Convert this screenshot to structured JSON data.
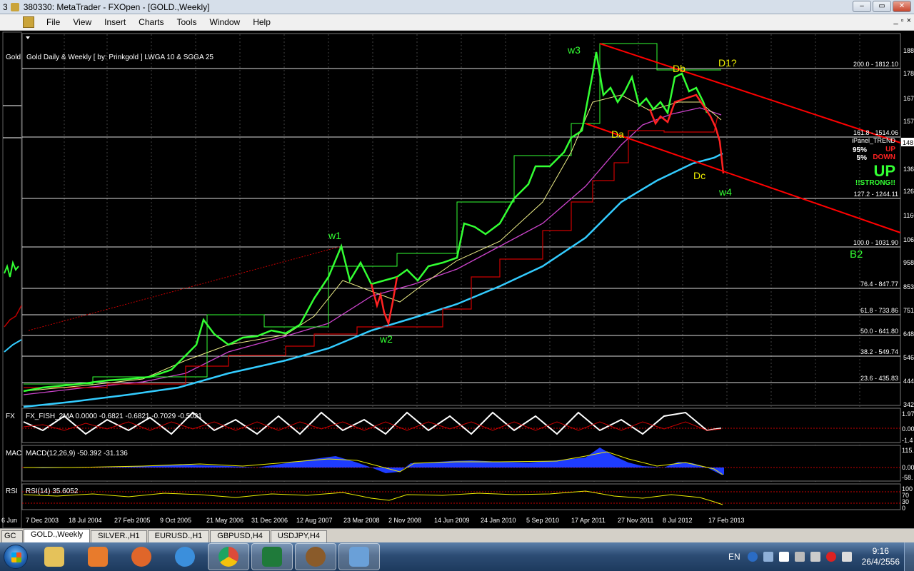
{
  "window": {
    "title_prefix": "3",
    "title": "380330: MetaTrader - FXOpen - [GOLD.,Weekly]",
    "controls": [
      "–",
      "▭",
      "✕"
    ]
  },
  "menu": {
    "items": [
      "File",
      "View",
      "Insert",
      "Charts",
      "Tools",
      "Window",
      "Help"
    ],
    "mdi_controls": [
      "_",
      "▫",
      "×"
    ]
  },
  "chart": {
    "symbol_label": "Gold",
    "header": "Gold Daily & Weekly [ by: Prinkgold ] LWGA 10 & SGGA 25",
    "price_axis": [
      "1880",
      "1780",
      "1670",
      "1570",
      "1480",
      "1360",
      "1260",
      "1160",
      "1060",
      "958",
      "853",
      "751",
      "648",
      "546",
      "444",
      "342"
    ],
    "price_box": "148",
    "fib_levels": [
      "200.0 - 1812.10",
      "161.8 - 1514.06",
      "127.2 - 1244.11",
      "100.0 - 1031.90",
      "76.4 - 847.77",
      "61.8 - 733.86",
      "50.0 - 641.80",
      "38.2 - 549.74",
      "23.6 - 435.83"
    ],
    "wave_labels": [
      "w1",
      "w2",
      "w3",
      "w4",
      "Da",
      "Db",
      "Dc",
      "D1?",
      "B2"
    ],
    "ipanel": {
      "title": "iPanel_TREND",
      "pct_up": "95%",
      "pct_down": "5%",
      "up": "UP",
      "down": "DOWN",
      "big_up": "UP",
      "strong": "!!STRONG!!"
    },
    "time_axis": [
      "6 Jun",
      "7 Dec 2003",
      "18 Jul 2004",
      "27 Feb 2005",
      "9 Oct 2005",
      "21 May 2006",
      "31 Dec 2006",
      "12 Aug 2007",
      "23 Mar 2008",
      "2 Nov 2008",
      "14 Jun 2009",
      "24 Jan 2010",
      "5 Sep 2010",
      "17 Apr 2011",
      "27 Nov 2011",
      "8 Jul 2012",
      "17 Feb 2013"
    ]
  },
  "indicators": {
    "fx": {
      "short": "FX",
      "label": "FX_FISH_2MA 0.0000 -0.6821 -0.6821 -0.7029 -0.5021",
      "axis": [
        "1.97",
        "0.00",
        "-1.4"
      ]
    },
    "macd": {
      "short": "MAC",
      "label": "MACD(12,26,9) -50.392 -31.136",
      "axis": [
        "115.",
        "0.00",
        "-58."
      ]
    },
    "rsi": {
      "short": "RSI",
      "label": "RSI(14) 35.6052",
      "axis": [
        "100",
        "70",
        "30",
        "0"
      ]
    }
  },
  "tabs": [
    "GC",
    "GOLD.,Weekly",
    "SILVER.,H1",
    "EURUSD.,H1",
    "GBPUSD,H4",
    "USDJPY,H4"
  ],
  "taskbar": {
    "apps": [
      {
        "name": "explorer",
        "color": "#e5c25a"
      },
      {
        "name": "media-player",
        "color": "#e87b2c"
      },
      {
        "name": "firefox",
        "color": "#e0662a"
      },
      {
        "name": "internet-explorer",
        "color": "#3b8fdc"
      },
      {
        "name": "chrome",
        "color": "#dd4b39"
      },
      {
        "name": "excel",
        "color": "#1f7a3a"
      },
      {
        "name": "metatrader",
        "color": "#8a5b2a"
      },
      {
        "name": "paint",
        "color": "#6aa0d8"
      }
    ],
    "lang": "EN",
    "time": "9:16",
    "date": "26/4/2556"
  }
}
